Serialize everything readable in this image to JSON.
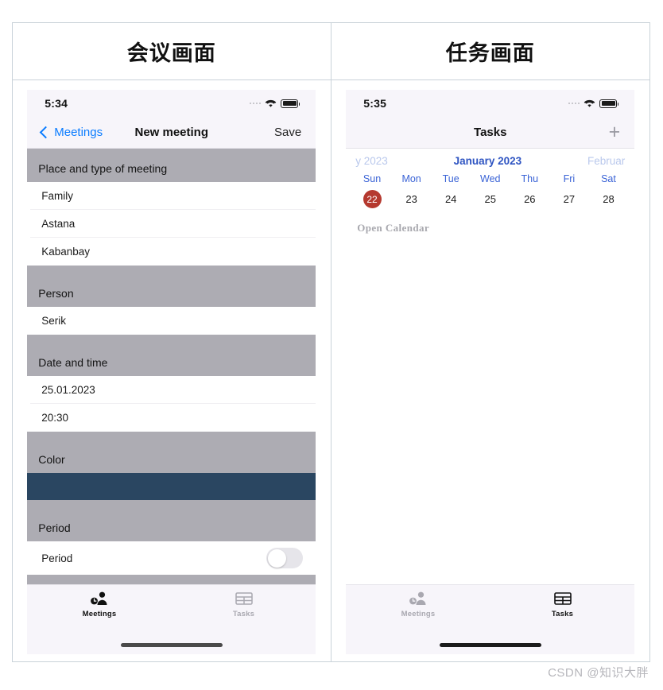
{
  "panels": [
    {
      "header": "会议画面",
      "statusbar": {
        "time": "5:34",
        "wifi_icon": "wifi-icon",
        "battery_icon": "battery-full-icon",
        "signal_icon": "signal-dots-icon"
      },
      "navbar": {
        "back_label": "Meetings",
        "back_icon": "chevron-left-icon",
        "title": "New meeting",
        "action_label": "Save"
      },
      "sections": [
        {
          "title": "Place and type of meeting",
          "rows": [
            "Family",
            "Astana",
            "Kabanbay"
          ]
        },
        {
          "title": "Person",
          "rows": [
            "Serik"
          ]
        },
        {
          "title": "Date and time",
          "rows": [
            "25.01.2023",
            "20:30"
          ]
        },
        {
          "title": "Color",
          "swatch": "#2a4661"
        },
        {
          "title": "Period",
          "toggle_label": "Period",
          "toggle_state": "off"
        }
      ],
      "tabs": [
        {
          "label": "Meetings",
          "icon": "meetings-icon",
          "active": true
        },
        {
          "label": "Tasks",
          "icon": "tasks-grid-icon",
          "active": false
        }
      ]
    },
    {
      "header": "任务画面",
      "statusbar": {
        "time": "5:35",
        "wifi_icon": "wifi-icon",
        "battery_icon": "battery-full-icon",
        "signal_icon": "signal-dots-icon"
      },
      "navbar": {
        "title": "Tasks",
        "action_icon": "plus-icon"
      },
      "calendar": {
        "prev_month": "y 2023",
        "current_month": "January 2023",
        "next_month": "Februar",
        "weekdays": [
          "Sun",
          "Mon",
          "Tue",
          "Wed",
          "Thu",
          "Fri",
          "Sat"
        ],
        "days": [
          "22",
          "23",
          "24",
          "25",
          "26",
          "27",
          "28"
        ],
        "selected_day": "22",
        "selected_color": "#b5392f",
        "open_calendar_label": "Open Calendar"
      },
      "tabs": [
        {
          "label": "Meetings",
          "icon": "meetings-icon",
          "active": false
        },
        {
          "label": "Tasks",
          "icon": "tasks-grid-icon",
          "active": true
        }
      ]
    }
  ],
  "watermark": "CSDN @知识大胖"
}
